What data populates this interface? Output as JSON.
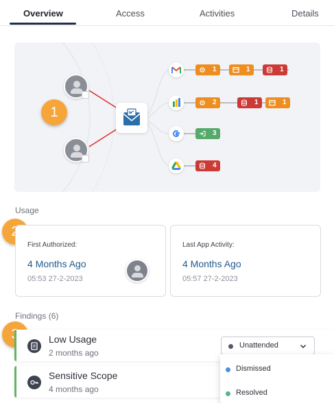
{
  "tabs": [
    {
      "label": "Overview",
      "active": true
    },
    {
      "label": "Access",
      "active": false
    },
    {
      "label": "Activities",
      "active": false
    },
    {
      "label": "Details",
      "active": false
    }
  ],
  "graph": {
    "apps": [
      {
        "icon": "gmail-icon",
        "chips": [
          {
            "icon": "gear-icon",
            "count": "1",
            "color": "#ee8e20"
          },
          {
            "icon": "window-icon",
            "count": "1",
            "color": "#ee8e20"
          },
          {
            "icon": "database-icon",
            "count": "1",
            "color": "#cc3a36"
          }
        ]
      },
      {
        "icon": "google-sheets-icon",
        "chips": [
          {
            "icon": "gear-icon",
            "count": "2",
            "color": "#ee8e20"
          },
          {
            "icon": "database-icon",
            "count": "1",
            "color": "#cc3a36"
          },
          {
            "icon": "window-icon",
            "count": "1",
            "color": "#ee8e20"
          }
        ]
      },
      {
        "icon": "google-icon",
        "chips": [
          {
            "icon": "login-icon",
            "count": "3",
            "color": "#55a96a"
          }
        ]
      },
      {
        "icon": "google-drive-icon",
        "chips": [
          {
            "icon": "database-icon",
            "count": "4",
            "color": "#cc3a36"
          }
        ]
      }
    ]
  },
  "badges": [
    "1",
    "2",
    "3"
  ],
  "usage": {
    "label": "Usage",
    "first": {
      "label": "First Authorized:",
      "value": "4 Months Ago",
      "date": "05:53 27-2-2023"
    },
    "last": {
      "label": "Last App Activity:",
      "value": "4 Months Ago",
      "date": "05:57 27-2-2023"
    }
  },
  "findings": {
    "label": "Findings (6)",
    "items": [
      {
        "title": "Low Usage",
        "sub": "2 months ago"
      },
      {
        "title": "Sensitive Scope",
        "sub": "4 months ago"
      }
    ],
    "status": {
      "selected": "Unattended",
      "options": [
        {
          "label": "Dismissed",
          "color": "#4a90e2"
        },
        {
          "label": "Resolved",
          "color": "#52b788"
        }
      ]
    }
  },
  "colors": {
    "accent": "#1f2d4d",
    "badge": "#f6a53a",
    "orange": "#ee8e20",
    "red": "#cc3a36",
    "green": "#55a96a",
    "link": "#225a8c"
  }
}
